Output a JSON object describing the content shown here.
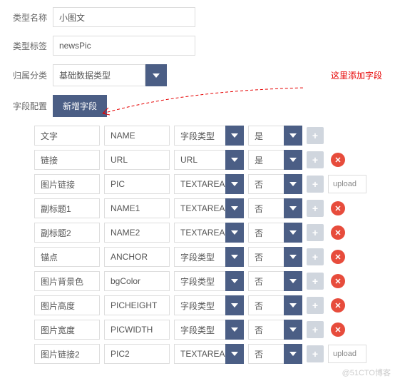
{
  "labels": {
    "type_name": "类型名称",
    "type_tag": "类型标签",
    "category": "归属分类",
    "field_config": "字段配置"
  },
  "values": {
    "type_name": "小图文",
    "type_tag": "newsPic",
    "category": "基础数据类型"
  },
  "buttons": {
    "add_field": "新增字段"
  },
  "annotation": "这里添加字段",
  "opt_yes": "是",
  "opt_no": "否",
  "default_type": "字段类型",
  "rows": [
    {
      "label": "文字",
      "name": "NAME",
      "ftype": "字段类型",
      "req": "是",
      "ext": null,
      "del": false
    },
    {
      "label": "链接",
      "name": "URL",
      "ftype": "URL",
      "req": "是",
      "ext": null,
      "del": true
    },
    {
      "label": "图片链接",
      "name": "PIC",
      "ftype": "TEXTAREA",
      "req": "否",
      "ext": "upload",
      "del": false
    },
    {
      "label": "副标题1",
      "name": "NAME1",
      "ftype": "TEXTAREA",
      "req": "否",
      "ext": null,
      "del": true
    },
    {
      "label": "副标题2",
      "name": "NAME2",
      "ftype": "TEXTAREA",
      "req": "否",
      "ext": null,
      "del": true
    },
    {
      "label": "锚点",
      "name": "ANCHOR",
      "ftype": "字段类型",
      "req": "否",
      "ext": null,
      "del": true
    },
    {
      "label": "图片背景色",
      "name": "bgColor",
      "ftype": "字段类型",
      "req": "否",
      "ext": null,
      "del": true
    },
    {
      "label": "图片高度",
      "name": "PICHEIGHT",
      "ftype": "字段类型",
      "req": "否",
      "ext": null,
      "del": true
    },
    {
      "label": "图片宽度",
      "name": "PICWIDTH",
      "ftype": "字段类型",
      "req": "否",
      "ext": null,
      "del": true
    },
    {
      "label": "图片链接2",
      "name": "PIC2",
      "ftype": "TEXTAREA",
      "req": "否",
      "ext": "upload",
      "del": false
    }
  ],
  "watermark": "@51CTO博客"
}
